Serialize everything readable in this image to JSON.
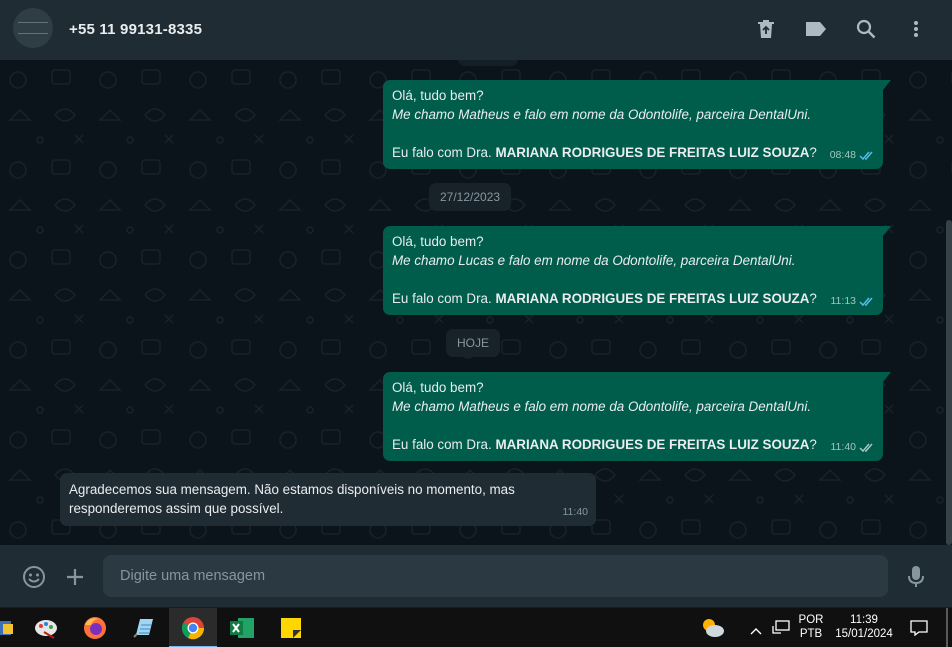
{
  "header": {
    "contact_name": "+55 11 99131-8335",
    "icons": [
      "archive-icon",
      "label-icon",
      "search-icon",
      "menu-dots-icon"
    ]
  },
  "messages": [
    {
      "direction": "out",
      "line1": "Olá, tudo bem?",
      "line2": "Me chamo Matheus e falo em nome da Odontolife, parceira DentalUni.",
      "line3_prefix": "Eu falo com Dra. ",
      "line3_name": "MARIANA RODRIGUES DE FREITAS LUIZ SOUZA",
      "line3_suffix": "?",
      "time": "08:48",
      "status": "read"
    },
    {
      "direction": "out",
      "line1": "Olá, tudo bem?",
      "line2": "Me chamo Lucas e falo em nome da Odontolife, parceira DentalUni.",
      "line3_prefix": "Eu falo com Dra. ",
      "line3_name": "MARIANA RODRIGUES DE FREITAS LUIZ SOUZA",
      "line3_suffix": "?",
      "time": "11:13",
      "status": "read"
    },
    {
      "direction": "out",
      "line1": "Olá, tudo bem?",
      "line2": "Me chamo Matheus e falo em nome da Odontolife, parceira DentalUni.",
      "line3_prefix": "Eu falo com Dra. ",
      "line3_name": "MARIANA RODRIGUES DE FREITAS LUIZ SOUZA",
      "line3_suffix": "?",
      "time": "11:40",
      "status": "delivered"
    },
    {
      "direction": "in",
      "text": "Agradecemos sua mensagem. Não estamos disponíveis no momento, mas responderemos assim que possível.",
      "time": "11:40"
    }
  ],
  "date_separators": [
    "27/12/2023",
    "HOJE"
  ],
  "composer": {
    "placeholder": "Digite uma mensagem"
  },
  "taskbar": {
    "apps": [
      "onenote-icon",
      "paint-icon",
      "firefox-icon",
      "notepad-icon",
      "chrome-icon",
      "excel-icon",
      "sticky-notes-icon"
    ],
    "active_app": "chrome-icon",
    "language_line1": "POR",
    "language_line2": "PTB",
    "time": "11:39",
    "date": "15/01/2024"
  },
  "colors": {
    "outgoing_bubble": "#005c4b",
    "incoming_bubble": "#202c33",
    "chat_background": "#0b141a",
    "read_ticks": "#53bdeb"
  }
}
